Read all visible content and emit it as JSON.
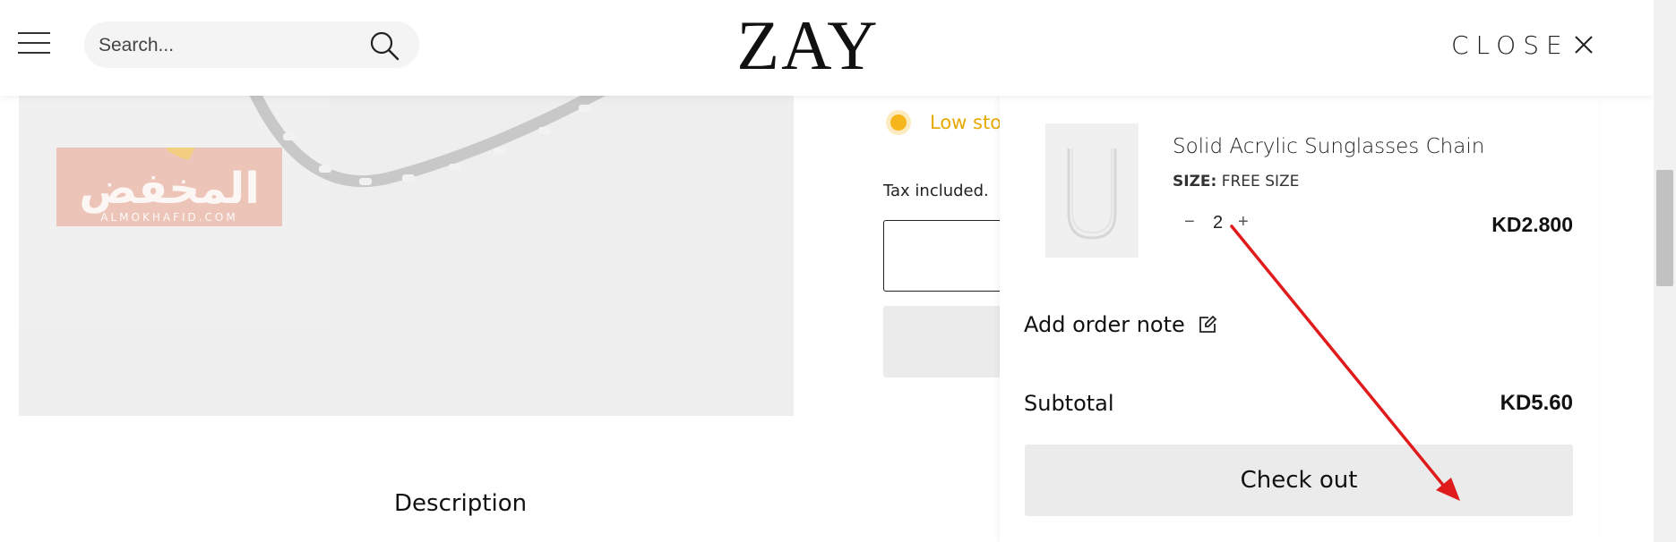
{
  "header": {
    "logo": "ZAY",
    "search": {
      "placeholder": "Search..."
    },
    "close_label": "CLOSE"
  },
  "product": {
    "stock_text": "Low sto",
    "tax_text": "Tax included.",
    "watermark_text": "المخفض",
    "watermark_sub": "ALMOKHAFID.COM"
  },
  "description_heading": "Description",
  "cart": {
    "item": {
      "title": "Solid Acrylic Sunglasses Chain",
      "size_label": "SIZE:",
      "size_value": "FREE SIZE",
      "qty_minus": "−",
      "quantity": "2",
      "qty_plus": "+",
      "price": "KD2.800"
    },
    "order_note_label": "Add order note",
    "subtotal_label": "Subtotal",
    "subtotal_value": "KD5.60",
    "checkout_label": "Check out"
  },
  "icons": [
    "menu-icon",
    "search-icon",
    "close-icon",
    "edit-icon"
  ],
  "colors": {
    "accent_stock": "#f6b51b",
    "arrow": "#e01b1b",
    "button_grey": "#ebebeb"
  }
}
